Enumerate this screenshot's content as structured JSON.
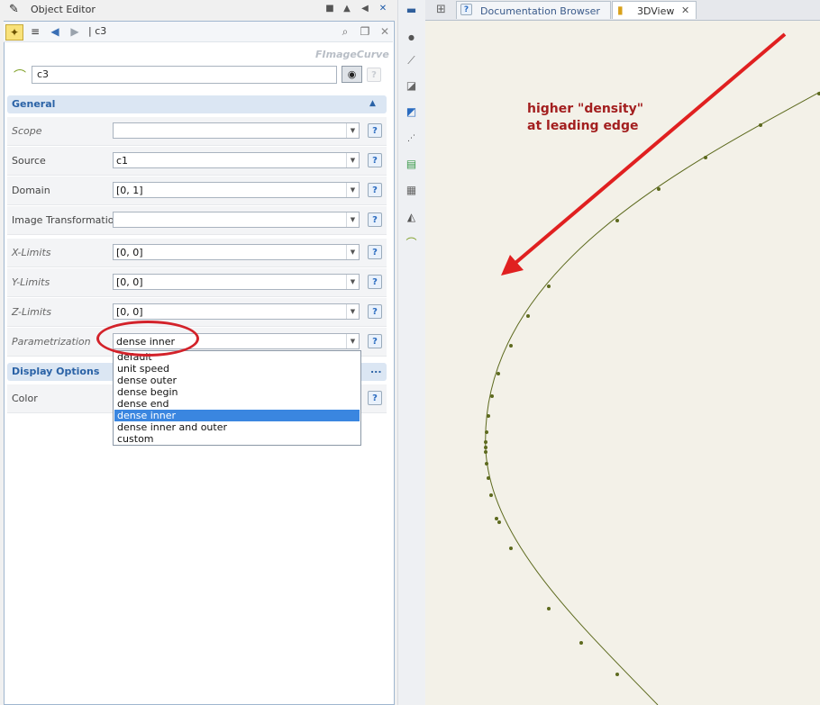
{
  "window": {
    "title": "Object Editor"
  },
  "toolbar": {
    "path": "| c3"
  },
  "object": {
    "type_label": "FImageCurve",
    "name": "c3"
  },
  "sections": {
    "general": {
      "label": "General"
    },
    "display": {
      "label": "Display Options",
      "more": "..."
    }
  },
  "rows": [
    {
      "label": "Scope",
      "value": ""
    },
    {
      "label": "Source",
      "value": "c1"
    },
    {
      "label": "Domain",
      "value": "[0, 1]"
    },
    {
      "label": "Image Transformation",
      "value": ""
    },
    {
      "label": "X-Limits",
      "value": "[0, 0]"
    },
    {
      "label": "Y-Limits",
      "value": "[0, 0]"
    },
    {
      "label": "Z-Limits",
      "value": "[0, 0]"
    },
    {
      "label": "Parametrization",
      "value": "dense inner"
    }
  ],
  "color_row": {
    "label": "Color"
  },
  "dropdown": {
    "options": [
      "default",
      "unit speed",
      "dense outer",
      "dense begin",
      "dense end",
      "dense inner",
      "dense inner and outer",
      "custom"
    ],
    "selected": "dense inner"
  },
  "help_symbol": "?",
  "tabs": [
    {
      "label": "Documentation Browser"
    },
    {
      "label": "3DView",
      "active": true
    }
  ],
  "view": {
    "annotation_line1": "higher \"density\"",
    "annotation_line2": "at leading edge",
    "background": "#f3f1e8",
    "curve_color": "#5d6a1e",
    "arrow_color": "#e02020"
  }
}
